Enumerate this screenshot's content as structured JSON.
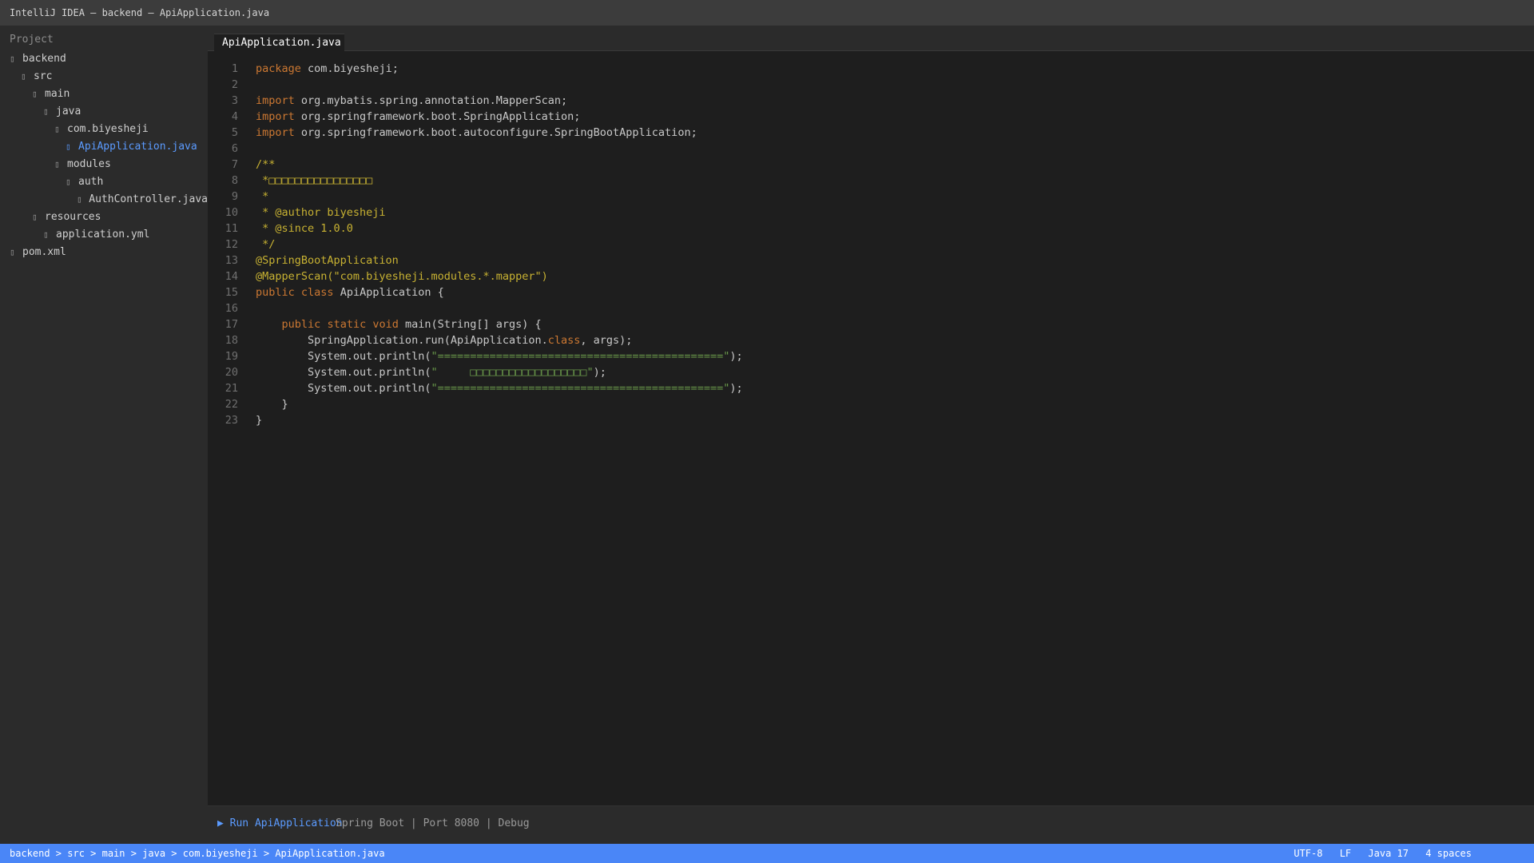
{
  "window": {
    "title": "IntelliJ IDEA — backend — ApiApplication.java"
  },
  "sidebar": {
    "title": "Project",
    "items": [
      {
        "label": "backend",
        "depth": 0,
        "icon": "folder-icon",
        "active": false
      },
      {
        "label": "src",
        "depth": 1,
        "icon": "folder-icon",
        "active": false
      },
      {
        "label": "main",
        "depth": 2,
        "icon": "folder-icon",
        "active": false
      },
      {
        "label": "java",
        "depth": 3,
        "icon": "folder-icon",
        "active": false
      },
      {
        "label": "com.biyesheji",
        "depth": 4,
        "icon": "package-icon",
        "active": false
      },
      {
        "label": "ApiApplication.java",
        "depth": 5,
        "icon": "java-file-icon",
        "active": true
      },
      {
        "label": "modules",
        "depth": 4,
        "icon": "folder-icon",
        "active": false
      },
      {
        "label": "auth",
        "depth": 5,
        "icon": "folder-icon",
        "active": false
      },
      {
        "label": "AuthController.java",
        "depth": 6,
        "icon": "java-file-icon",
        "active": false
      },
      {
        "label": "resources",
        "depth": 2,
        "icon": "folder-icon",
        "active": false
      },
      {
        "label": "application.yml",
        "depth": 3,
        "icon": "yaml-file-icon",
        "active": false
      },
      {
        "label": "pom.xml",
        "depth": 0,
        "icon": "xml-file-icon",
        "active": false
      }
    ]
  },
  "editor": {
    "tabs": [
      {
        "label": "ApiApplication.java",
        "active": true
      }
    ],
    "lines": [
      [
        {
          "t": "package",
          "c": "kw"
        },
        {
          "t": " com.biyesheji;",
          "c": ""
        }
      ],
      [],
      [
        {
          "t": "import",
          "c": "kw"
        },
        {
          "t": " org.mybatis.spring.annotation.MapperScan;",
          "c": ""
        }
      ],
      [
        {
          "t": "import",
          "c": "kw"
        },
        {
          "t": " org.springframework.boot.SpringApplication;",
          "c": ""
        }
      ],
      [
        {
          "t": "import",
          "c": "kw"
        },
        {
          "t": " org.springframework.boot.autoconfigure.SpringBootApplication;",
          "c": ""
        }
      ],
      [],
      [
        {
          "t": "/**",
          "c": "cm"
        }
      ],
      [
        {
          "t": " *□□□□□□□□□□□□□□□□",
          "c": "cm"
        }
      ],
      [
        {
          "t": " *",
          "c": "cm"
        }
      ],
      [
        {
          "t": " * @author biyesheji",
          "c": "cm"
        }
      ],
      [
        {
          "t": " * @since 1.0.0",
          "c": "cm"
        }
      ],
      [
        {
          "t": " */",
          "c": "cm"
        }
      ],
      [
        {
          "t": "@SpringBootApplication",
          "c": "an"
        }
      ],
      [
        {
          "t": "@MapperScan(\"com.biyesheji.modules.*.mapper\")",
          "c": "an"
        }
      ],
      [
        {
          "t": "public",
          "c": "kw"
        },
        {
          "t": " ",
          "c": ""
        },
        {
          "t": "class",
          "c": "kw"
        },
        {
          "t": " ApiApplication {",
          "c": ""
        }
      ],
      [],
      [
        {
          "t": "    ",
          "c": ""
        },
        {
          "t": "public",
          "c": "kw"
        },
        {
          "t": " ",
          "c": ""
        },
        {
          "t": "static",
          "c": "kw"
        },
        {
          "t": " ",
          "c": ""
        },
        {
          "t": "void",
          "c": "kw"
        },
        {
          "t": " main(String[] args) {",
          "c": ""
        }
      ],
      [
        {
          "t": "        SpringApplication.run(ApiApplication.",
          "c": ""
        },
        {
          "t": "class",
          "c": "kw"
        },
        {
          "t": ", args);",
          "c": ""
        }
      ],
      [
        {
          "t": "        System.out.println(",
          "c": ""
        },
        {
          "t": "\"============================================\"",
          "c": "st"
        },
        {
          "t": ");",
          "c": ""
        }
      ],
      [
        {
          "t": "        System.out.println(",
          "c": ""
        },
        {
          "t": "\"     □□□□□□□□□□□□□□□□□□\"",
          "c": "st"
        },
        {
          "t": ");",
          "c": ""
        }
      ],
      [
        {
          "t": "        System.out.println(",
          "c": ""
        },
        {
          "t": "\"============================================\"",
          "c": "st"
        },
        {
          "t": ");",
          "c": ""
        }
      ],
      [
        {
          "t": "    }",
          "c": ""
        }
      ],
      [
        {
          "t": "}",
          "c": ""
        }
      ]
    ]
  },
  "runbar": {
    "run_label": "▶ Run ApiApplication",
    "info": "Spring Boot  |  Port 8080  |  Debug"
  },
  "statusbar": {
    "breadcrumbs": "backend > src > main > java > com.biyesheji > ApiApplication.java",
    "encoding": "UTF-8",
    "line_sep": "LF",
    "sdk": "Java 17",
    "indent": "4 spaces"
  },
  "colors": {
    "accent": "#4a86f7",
    "keyword": "#cc7832",
    "comment": "#c8b232",
    "string": "#6a9a4a"
  }
}
